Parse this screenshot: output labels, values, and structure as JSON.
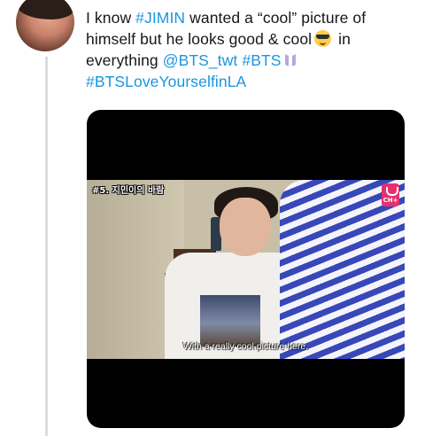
{
  "tweet": {
    "text_part1": "I know ",
    "hashtag_jimin": "#JIMIN",
    "text_part2": " wanted a “cool” picture of himself but he looks good & cool",
    "emoji": "smiling-face-with-sunglasses",
    "text_part3": " in everything ",
    "mention": "@BTS_twt",
    "hashtag_bts": "#BTS",
    "bts_logo": "bts-logo",
    "hashtag_love": "#BTSLoveYourselfinLA"
  },
  "video": {
    "episode_tag": "#5. 지민이의 바람",
    "subtitle": "With a really cool picture here.",
    "badge": "CH+"
  },
  "colors": {
    "link": "#1b95e0",
    "text": "#14171a",
    "thread_line": "#d9dde2",
    "media_background": "#000000"
  }
}
